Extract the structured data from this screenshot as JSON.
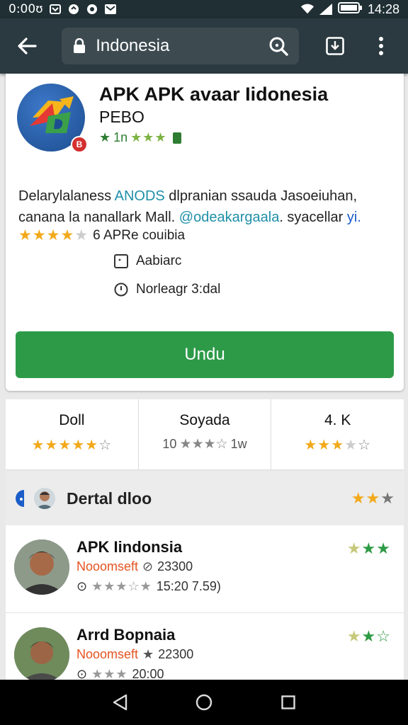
{
  "status_bar": {
    "left_text": "0:00ʊ",
    "time": "14:28"
  },
  "toolbar": {
    "url": "Indonesia",
    "icons": [
      "back-arrow-icon",
      "lock-icon",
      "search-icon",
      "download-icon",
      "more-vert-icon"
    ]
  },
  "app": {
    "title": "APK APK avaar Iidonesia",
    "developer": "PEBO",
    "rating_text": "1n",
    "rating_stars": 4,
    "description_parts": {
      "p1": "Delarylalaness ",
      "p2": "ANODS",
      "p3": " dlpranian ssauda Jasoeiuhan, canana la nanallark Mall. ",
      "p4": "@odeakargaala",
      "p5": ". syacellar ",
      "p6": "yi."
    },
    "rating_line_stars": 4,
    "rating_line_text": "6 APRe couibia",
    "info_1": "Aabiarc",
    "info_2": "Norleagr 3:dal",
    "download_label": "Undu",
    "colors": {
      "accent_green": "#2d9a48",
      "star_gold": "#f2a91a",
      "toolbar": "#2b3a40"
    }
  },
  "stats": [
    {
      "value": "Doll",
      "stars": 4,
      "extra": ""
    },
    {
      "value": "Soyada",
      "stars": 3,
      "extra_left": "10",
      "extra_right": "1w"
    },
    {
      "value": "4. K",
      "stars": 3,
      "extra": ""
    }
  ],
  "review_header": {
    "title": "Dertal dloo",
    "stars": 2
  },
  "reviews": [
    {
      "name": "APK Iindonsia",
      "brand": "Nooomseft",
      "number": "23300",
      "stars_grey": 3,
      "date": "15:20 7.59)",
      "stars": 3
    },
    {
      "name": "Arrd Bopnaia",
      "brand": "Nooomseft",
      "number": "22300",
      "stars_grey": 3,
      "date": "20:00",
      "stars": 3
    }
  ]
}
